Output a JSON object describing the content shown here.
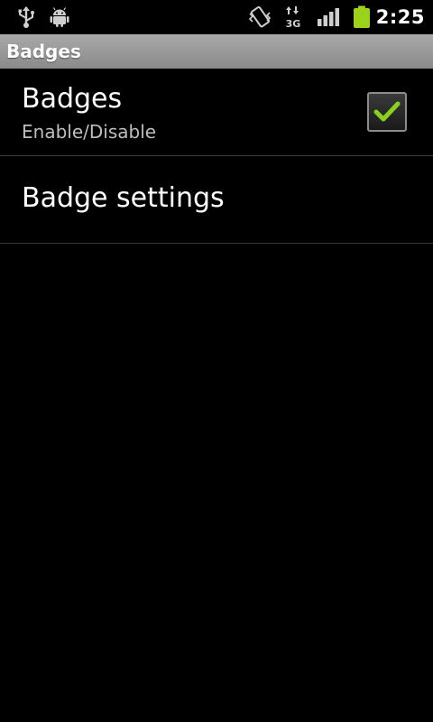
{
  "status_bar": {
    "time": "2:25",
    "network_label": "3G",
    "icons": [
      "usb-icon",
      "android-debug-icon",
      "vibrate-icon",
      "network-3g-icon",
      "signal-icon",
      "battery-icon"
    ],
    "battery_color": "#9ad31a"
  },
  "title_bar": {
    "title": "Badges"
  },
  "preferences": [
    {
      "title": "Badges",
      "summary": "Enable/Disable",
      "checked": true
    },
    {
      "title": "Badge settings"
    }
  ],
  "colors": {
    "background": "#000000",
    "title_bar": "#9a9a9a",
    "check_mark": "#8ad11f"
  }
}
